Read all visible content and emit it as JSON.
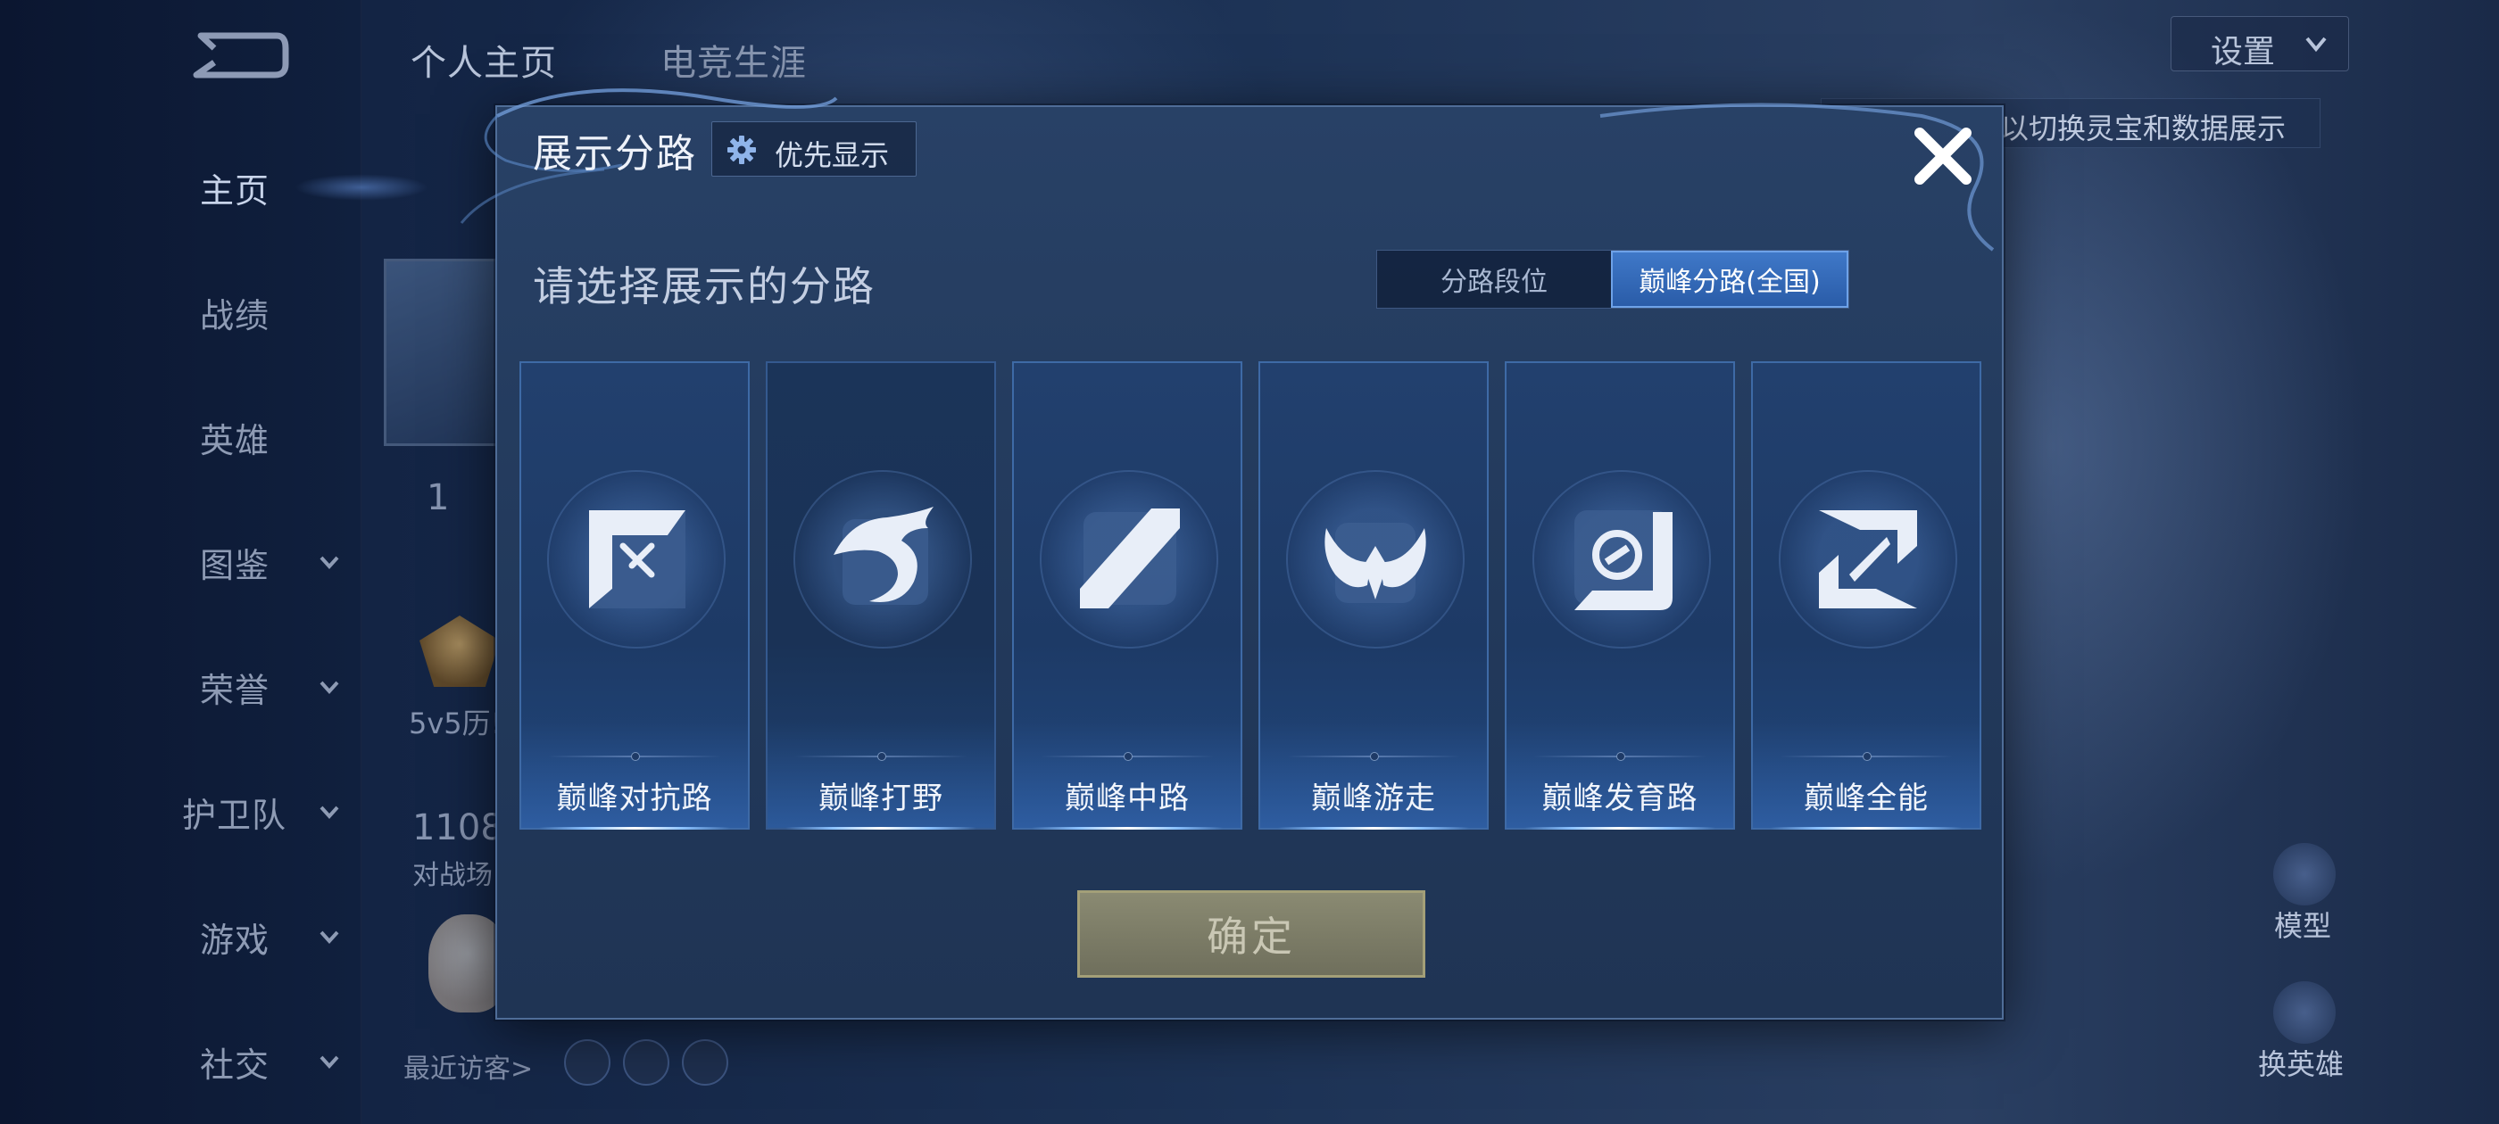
{
  "background": {
    "top_tabs": [
      "个人主页",
      "电竞生涯"
    ],
    "settings_label": "设置",
    "hint_text": "以切换灵宝和数据展示",
    "left_texts": [
      "1",
      "5v5历!",
      "1108",
      "对战场"
    ],
    "recent_visitors_label": "最近访客>",
    "right_buttons": [
      {
        "label": "模型",
        "icon": "model-icon"
      },
      {
        "label": "换英雄",
        "icon": "swap-hero-icon"
      }
    ]
  },
  "sidebar": {
    "items": [
      {
        "label": "主页",
        "active": true,
        "has_chevron": false
      },
      {
        "label": "战绩",
        "active": false,
        "has_chevron": false
      },
      {
        "label": "英雄",
        "active": false,
        "has_chevron": false
      },
      {
        "label": "图鉴",
        "active": false,
        "has_chevron": true
      },
      {
        "label": "荣誉",
        "active": false,
        "has_chevron": true
      },
      {
        "label": "护卫队",
        "active": false,
        "has_chevron": true
      },
      {
        "label": "游戏",
        "active": false,
        "has_chevron": true
      },
      {
        "label": "社交",
        "active": false,
        "has_chevron": true
      }
    ]
  },
  "modal": {
    "title": "展示分路",
    "priority_label": "优先显示",
    "subtitle": "请选择展示的分路",
    "segments": [
      {
        "label": "分路段位",
        "selected": false
      },
      {
        "label": "巅峰分路(全国)",
        "selected": true
      }
    ],
    "lanes": [
      {
        "name": "巅峰对抗路",
        "icon": "clash-lane-icon"
      },
      {
        "name": "巅峰打野",
        "icon": "jungle-dragon-icon"
      },
      {
        "name": "巅峰中路",
        "icon": "mid-lane-icon"
      },
      {
        "name": "巅峰游走",
        "icon": "roam-wings-icon"
      },
      {
        "name": "巅峰发育路",
        "icon": "farm-lane-icon"
      },
      {
        "name": "巅峰全能",
        "icon": "all-round-icon"
      }
    ],
    "confirm_label": "确定",
    "colors": {
      "accent": "#3f78c8",
      "confirm_disabled": "#7a7a66"
    }
  }
}
